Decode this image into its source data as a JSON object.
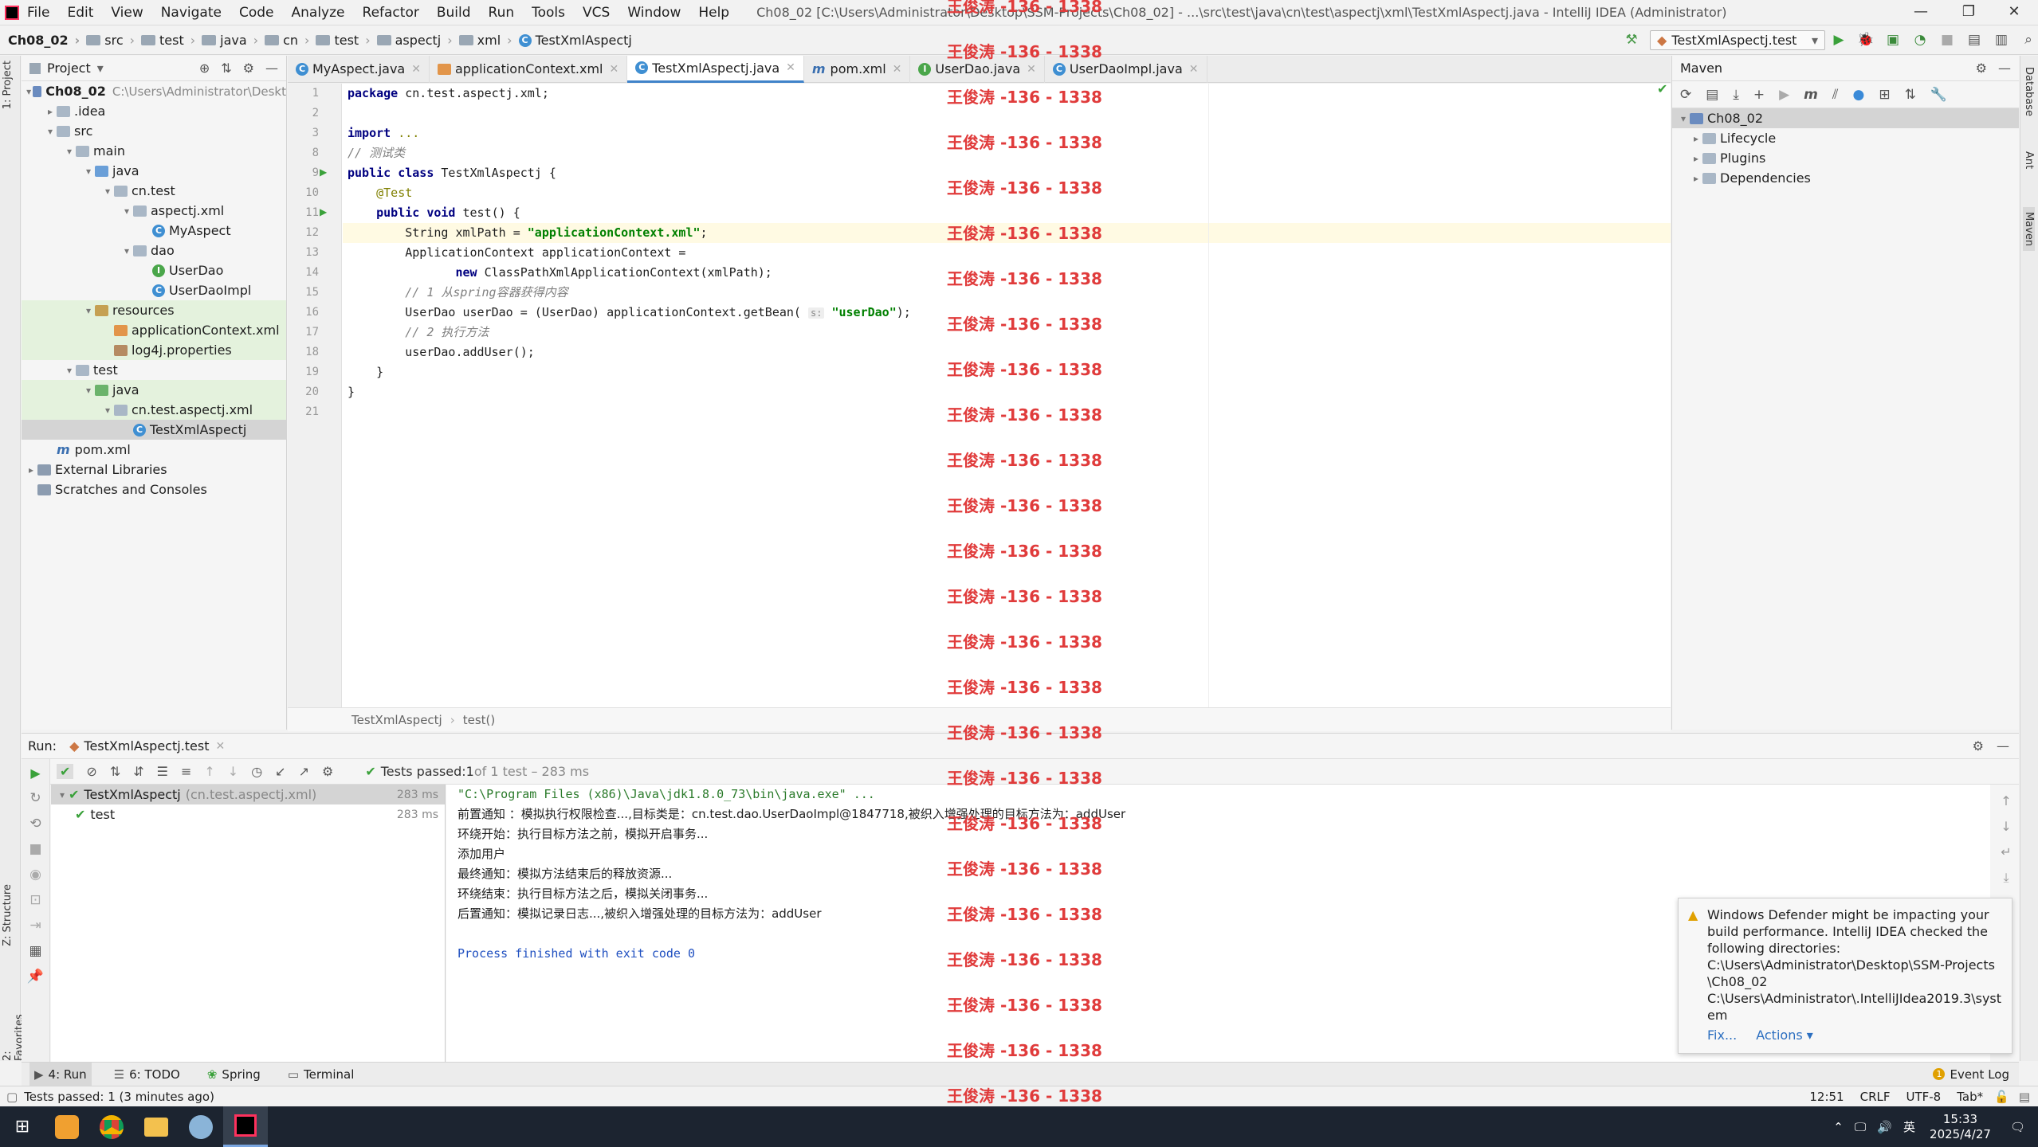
{
  "menu": {
    "items": [
      "File",
      "Edit",
      "View",
      "Navigate",
      "Code",
      "Analyze",
      "Refactor",
      "Build",
      "Run",
      "Tools",
      "VCS",
      "Window",
      "Help"
    ],
    "window_title": "Ch08_02 [C:\\Users\\Administrator\\Desktop\\SSM-Projects\\Ch08_02] - ...\\src\\test\\java\\cn\\test\\aspectj\\xml\\TestXmlAspectj.java - IntelliJ IDEA (Administrator)"
  },
  "breadcrumb": [
    "Ch08_02",
    "src",
    "test",
    "java",
    "cn",
    "test",
    "aspectj",
    "xml",
    "TestXmlAspectj"
  ],
  "run_config": "TestXmlAspectj.test",
  "project": {
    "header": "Project",
    "tree": [
      {
        "label": "Ch08_02",
        "extra": "C:\\Users\\Administrator\\Deskt",
        "depth": 0,
        "arrow": "▾",
        "icon": "mod",
        "bold": true
      },
      {
        "label": ".idea",
        "depth": 1,
        "arrow": "▸",
        "icon": "folder"
      },
      {
        "label": "src",
        "depth": 1,
        "arrow": "▾",
        "icon": "folder"
      },
      {
        "label": "main",
        "depth": 2,
        "arrow": "▾",
        "icon": "folder"
      },
      {
        "label": "java",
        "depth": 3,
        "arrow": "▾",
        "icon": "src"
      },
      {
        "label": "cn.test",
        "depth": 4,
        "arrow": "▾",
        "icon": "folder"
      },
      {
        "label": "aspectj.xml",
        "depth": 5,
        "arrow": "▾",
        "icon": "folder"
      },
      {
        "label": "MyAspect",
        "depth": 6,
        "arrow": "",
        "icon": "class"
      },
      {
        "label": "dao",
        "depth": 5,
        "arrow": "▾",
        "icon": "folder"
      },
      {
        "label": "UserDao",
        "depth": 6,
        "arrow": "",
        "icon": "iface"
      },
      {
        "label": "UserDaoImpl",
        "depth": 6,
        "arrow": "",
        "icon": "class"
      },
      {
        "label": "resources",
        "depth": 3,
        "arrow": "▾",
        "icon": "res",
        "green": true
      },
      {
        "label": "applicationContext.xml",
        "depth": 4,
        "arrow": "",
        "icon": "xml",
        "green": true
      },
      {
        "label": "log4j.properties",
        "depth": 4,
        "arrow": "",
        "icon": "prop",
        "green": true
      },
      {
        "label": "test",
        "depth": 2,
        "arrow": "▾",
        "icon": "folder"
      },
      {
        "label": "java",
        "depth": 3,
        "arrow": "▾",
        "icon": "test",
        "green": true
      },
      {
        "label": "cn.test.aspectj.xml",
        "depth": 4,
        "arrow": "▾",
        "icon": "folder",
        "green": true
      },
      {
        "label": "TestXmlAspectj",
        "depth": 5,
        "arrow": "",
        "icon": "class",
        "selected": true
      },
      {
        "label": "pom.xml",
        "depth": 1,
        "arrow": "",
        "icon": "pom"
      },
      {
        "label": "External Libraries",
        "depth": 0,
        "arrow": "▸",
        "icon": "lib"
      },
      {
        "label": "Scratches and Consoles",
        "depth": 0,
        "arrow": "",
        "icon": "lib"
      }
    ]
  },
  "editor_tabs": [
    {
      "label": "MyAspect.java",
      "icon": "class"
    },
    {
      "label": "applicationContext.xml",
      "icon": "xml"
    },
    {
      "label": "TestXmlAspectj.java",
      "icon": "class",
      "active": true
    },
    {
      "label": "pom.xml",
      "icon": "pom"
    },
    {
      "label": "UserDao.java",
      "icon": "iface"
    },
    {
      "label": "UserDaoImpl.java",
      "icon": "class"
    }
  ],
  "line_numbers": [
    "1",
    "2",
    "3",
    "8",
    "9",
    "10",
    "11",
    "12",
    "13",
    "14",
    "15",
    "16",
    "17",
    "18",
    "19",
    "20",
    "21"
  ],
  "code_lines": [
    [
      {
        "t": "package ",
        "c": "kw"
      },
      {
        "t": "cn.test.aspectj.xml;"
      }
    ],
    [],
    [
      {
        "t": "import ",
        "c": "kw"
      },
      {
        "t": "...",
        "c": "an"
      }
    ],
    [
      {
        "t": "// 测试类",
        "c": "cm"
      }
    ],
    [
      {
        "t": "public class ",
        "c": "kw"
      },
      {
        "t": "TestXmlAspectj {"
      }
    ],
    [
      {
        "t": "    "
      },
      {
        "t": "@Test",
        "c": "an"
      }
    ],
    [
      {
        "t": "    "
      },
      {
        "t": "public void ",
        "c": "kw"
      },
      {
        "t": "test() {"
      }
    ],
    [
      {
        "t": "        String xmlPath = "
      },
      {
        "t": "\"applicationContext.xml\"",
        "c": "str"
      },
      {
        "t": ";"
      }
    ],
    [
      {
        "t": "        ApplicationContext applicationContext ="
      }
    ],
    [
      {
        "t": "               "
      },
      {
        "t": "new ",
        "c": "kw"
      },
      {
        "t": "ClassPathXmlApplicationContext(xmlPath);"
      }
    ],
    [
      {
        "t": "        "
      },
      {
        "t": "// 1 从spring容器获得内容",
        "c": "cm"
      }
    ],
    [
      {
        "t": "        UserDao userDao = (UserDao) applicationContext.getBean( "
      },
      {
        "t": "s:",
        "c": "hint"
      },
      {
        "t": " "
      },
      {
        "t": "\"userDao\"",
        "c": "str"
      },
      {
        "t": ");"
      }
    ],
    [
      {
        "t": "        "
      },
      {
        "t": "// 2 执行方法",
        "c": "cm"
      }
    ],
    [
      {
        "t": "        userDao.addUser();"
      }
    ],
    [
      {
        "t": "    }"
      }
    ],
    [
      {
        "t": "}"
      }
    ],
    []
  ],
  "editor_breadcrumb": [
    "TestXmlAspectj",
    "test()"
  ],
  "maven": {
    "header": "Maven",
    "root": "Ch08_02",
    "children": [
      "Lifecycle",
      "Plugins",
      "Dependencies"
    ]
  },
  "run": {
    "label": "Run:",
    "tab": "TestXmlAspectj.test",
    "tests_passed": "Tests passed: ",
    "tests_count": "1",
    "tests_of": " of 1 test – 283 ms",
    "tree": [
      {
        "label": "TestXmlAspectj",
        "extra": "(cn.test.aspectj.xml)",
        "time": "283 ms"
      },
      {
        "label": "test",
        "extra": "",
        "time": "283 ms"
      }
    ],
    "console": [
      {
        "t": "\"C:\\Program Files (x86)\\Java\\jdk1.8.0_73\\bin\\java.exe\" ...",
        "c": "cmd"
      },
      {
        "t": "前置通知 ：模拟执行权限检查...,目标类是：cn.test.dao.UserDaoImpl@1847718,被织入增强处理的目标方法为：addUser"
      },
      {
        "t": "环绕开始：执行目标方法之前，模拟开启事务..."
      },
      {
        "t": "添加用户"
      },
      {
        "t": "最终通知：模拟方法结束后的释放资源..."
      },
      {
        "t": "环绕结束：执行目标方法之后，模拟关闭事务..."
      },
      {
        "t": "后置通知：模拟记录日志...,被织入增强处理的目标方法为：addUser"
      },
      {
        "t": ""
      },
      {
        "t": "Process finished with exit code 0",
        "c": "exit"
      }
    ]
  },
  "notification": {
    "text": "Windows Defender might be impacting your build performance. IntelliJ IDEA checked the following directories:",
    "dir1": "C:\\Users\\Administrator\\Desktop\\SSM-Projects\\Ch08_02",
    "dir2": "C:\\Users\\Administrator\\.IntelliJIdea2019.3\\system",
    "fix": "Fix...",
    "actions": "Actions ▾"
  },
  "bottom_tabs": [
    "4: Run",
    "6: TODO",
    "Spring",
    "Terminal"
  ],
  "event_log": "Event Log",
  "status": {
    "left": "Tests passed: 1 (3 minutes ago)",
    "position": "12:51",
    "line_sep": "CRLF",
    "encoding": "UTF-8",
    "indent": "Tab*"
  },
  "side_tabs": {
    "left_top": "1: Project",
    "left_mid": "Z: Structure",
    "left_bottom": "2: Favorites",
    "right_1": "Database",
    "right_2": "Ant",
    "right_3": "Maven"
  },
  "taskbar": {
    "time": "15:33",
    "date": "2025/4/27",
    "ime": "英"
  },
  "watermark": "王俊涛 -136 - 1338"
}
